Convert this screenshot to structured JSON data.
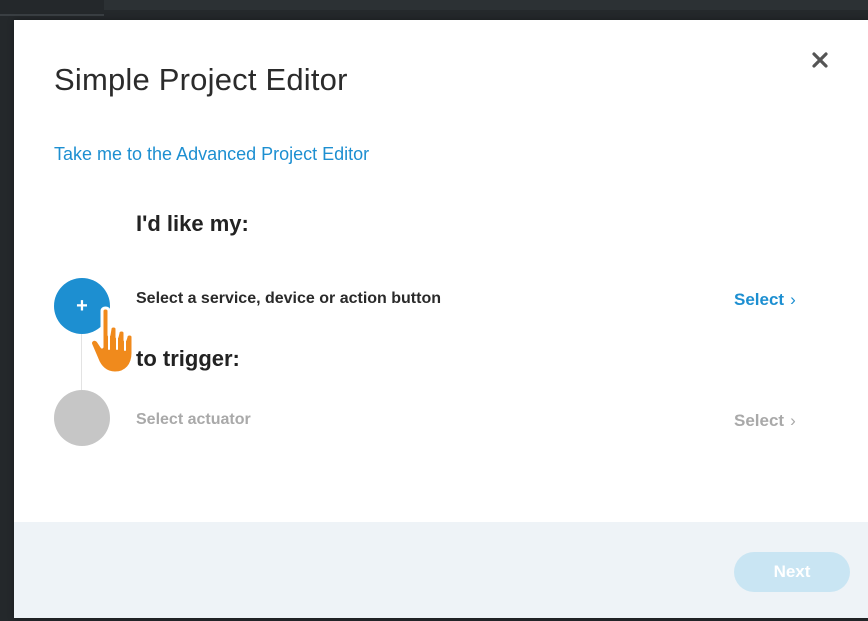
{
  "modal": {
    "title": "Simple Project Editor",
    "close_icon": "close-icon",
    "advanced_link": "Take me to the Advanced Project Editor"
  },
  "steps": [
    {
      "heading": "I'd like my:",
      "label": "Select a service, device or action button",
      "select_label": "Select",
      "circle_symbol": "+",
      "state": "active"
    },
    {
      "heading": "to trigger:",
      "label": "Select actuator",
      "select_label": "Select",
      "circle_symbol": "",
      "state": "disabled"
    }
  ],
  "footer": {
    "next_label": "Next"
  },
  "colors": {
    "accent": "#1d8fd1",
    "disabled_gray": "#a9a9a9",
    "next_disabled": "#c9e5f3",
    "cursor_orange": "#f08a1c"
  },
  "icons": {
    "chevron": "chevron-right-icon",
    "pointer": "hand-pointer-icon"
  }
}
